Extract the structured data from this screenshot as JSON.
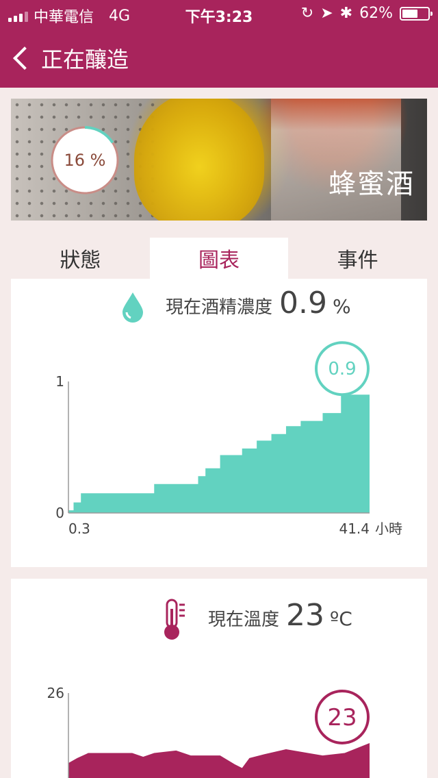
{
  "status_bar": {
    "carrier": "中華電信",
    "network": "4G",
    "time": "下午3:23",
    "battery": "62%",
    "battery_level": 0.62
  },
  "nav": {
    "title": "正在釀造"
  },
  "hero": {
    "progress_percent": 16,
    "progress_label": "16 %",
    "title": "蜂蜜酒"
  },
  "tabs": [
    {
      "label": "狀態",
      "active": false
    },
    {
      "label": "圖表",
      "active": true
    },
    {
      "label": "事件",
      "active": false
    }
  ],
  "alcohol_card": {
    "label": "現在酒精濃度",
    "value": "0.9",
    "unit": "%",
    "icon": "water-drop-icon",
    "color": "#62d2c0"
  },
  "temperature_card": {
    "label": "現在溫度",
    "value": "23",
    "unit": "ºC",
    "icon": "thermometer-icon",
    "color": "#a8245c"
  },
  "chart_data": [
    {
      "type": "area",
      "x_start_label": "0.3",
      "x_end_label": "41.4",
      "x_unit": "小時",
      "y_tick_labels": [
        "0",
        "1"
      ],
      "ylim": [
        0,
        1
      ],
      "xlim": [
        0.3,
        41.4
      ],
      "current_label": "0.9",
      "color": "#62d2c0",
      "x": [
        0.3,
        1.0,
        1.0,
        2.0,
        2.0,
        12.0,
        12.0,
        18.0,
        18.0,
        19.0,
        19.0,
        21.0,
        21.0,
        24.0,
        24.0,
        26.0,
        26.0,
        28.0,
        28.0,
        30.0,
        30.0,
        32.0,
        32.0,
        35.0,
        35.0,
        37.5,
        37.5,
        41.4
      ],
      "values": [
        0.02,
        0.02,
        0.08,
        0.08,
        0.15,
        0.15,
        0.22,
        0.22,
        0.28,
        0.28,
        0.34,
        0.34,
        0.44,
        0.44,
        0.49,
        0.49,
        0.55,
        0.55,
        0.6,
        0.6,
        0.66,
        0.66,
        0.7,
        0.7,
        0.76,
        0.76,
        0.9,
        0.9
      ]
    },
    {
      "type": "area",
      "y_tick_labels": [
        "26"
      ],
      "current_label": "23",
      "color": "#a8245c",
      "x": [
        0.3,
        1.5,
        3.0,
        6.0,
        9.0,
        10.5,
        12.0,
        15.0,
        17.0,
        19.0,
        21.0,
        23.0,
        24.0,
        25.0,
        27.0,
        30.0,
        33.0,
        35.0,
        38.0,
        41.4
      ],
      "values": [
        23.2,
        23.4,
        23.6,
        23.6,
        23.6,
        23.45,
        23.6,
        23.7,
        23.5,
        23.5,
        23.5,
        23.15,
        23.0,
        23.4,
        23.55,
        23.75,
        23.6,
        23.5,
        23.6,
        24.0
      ],
      "ylim": [
        22.6,
        26
      ]
    }
  ]
}
